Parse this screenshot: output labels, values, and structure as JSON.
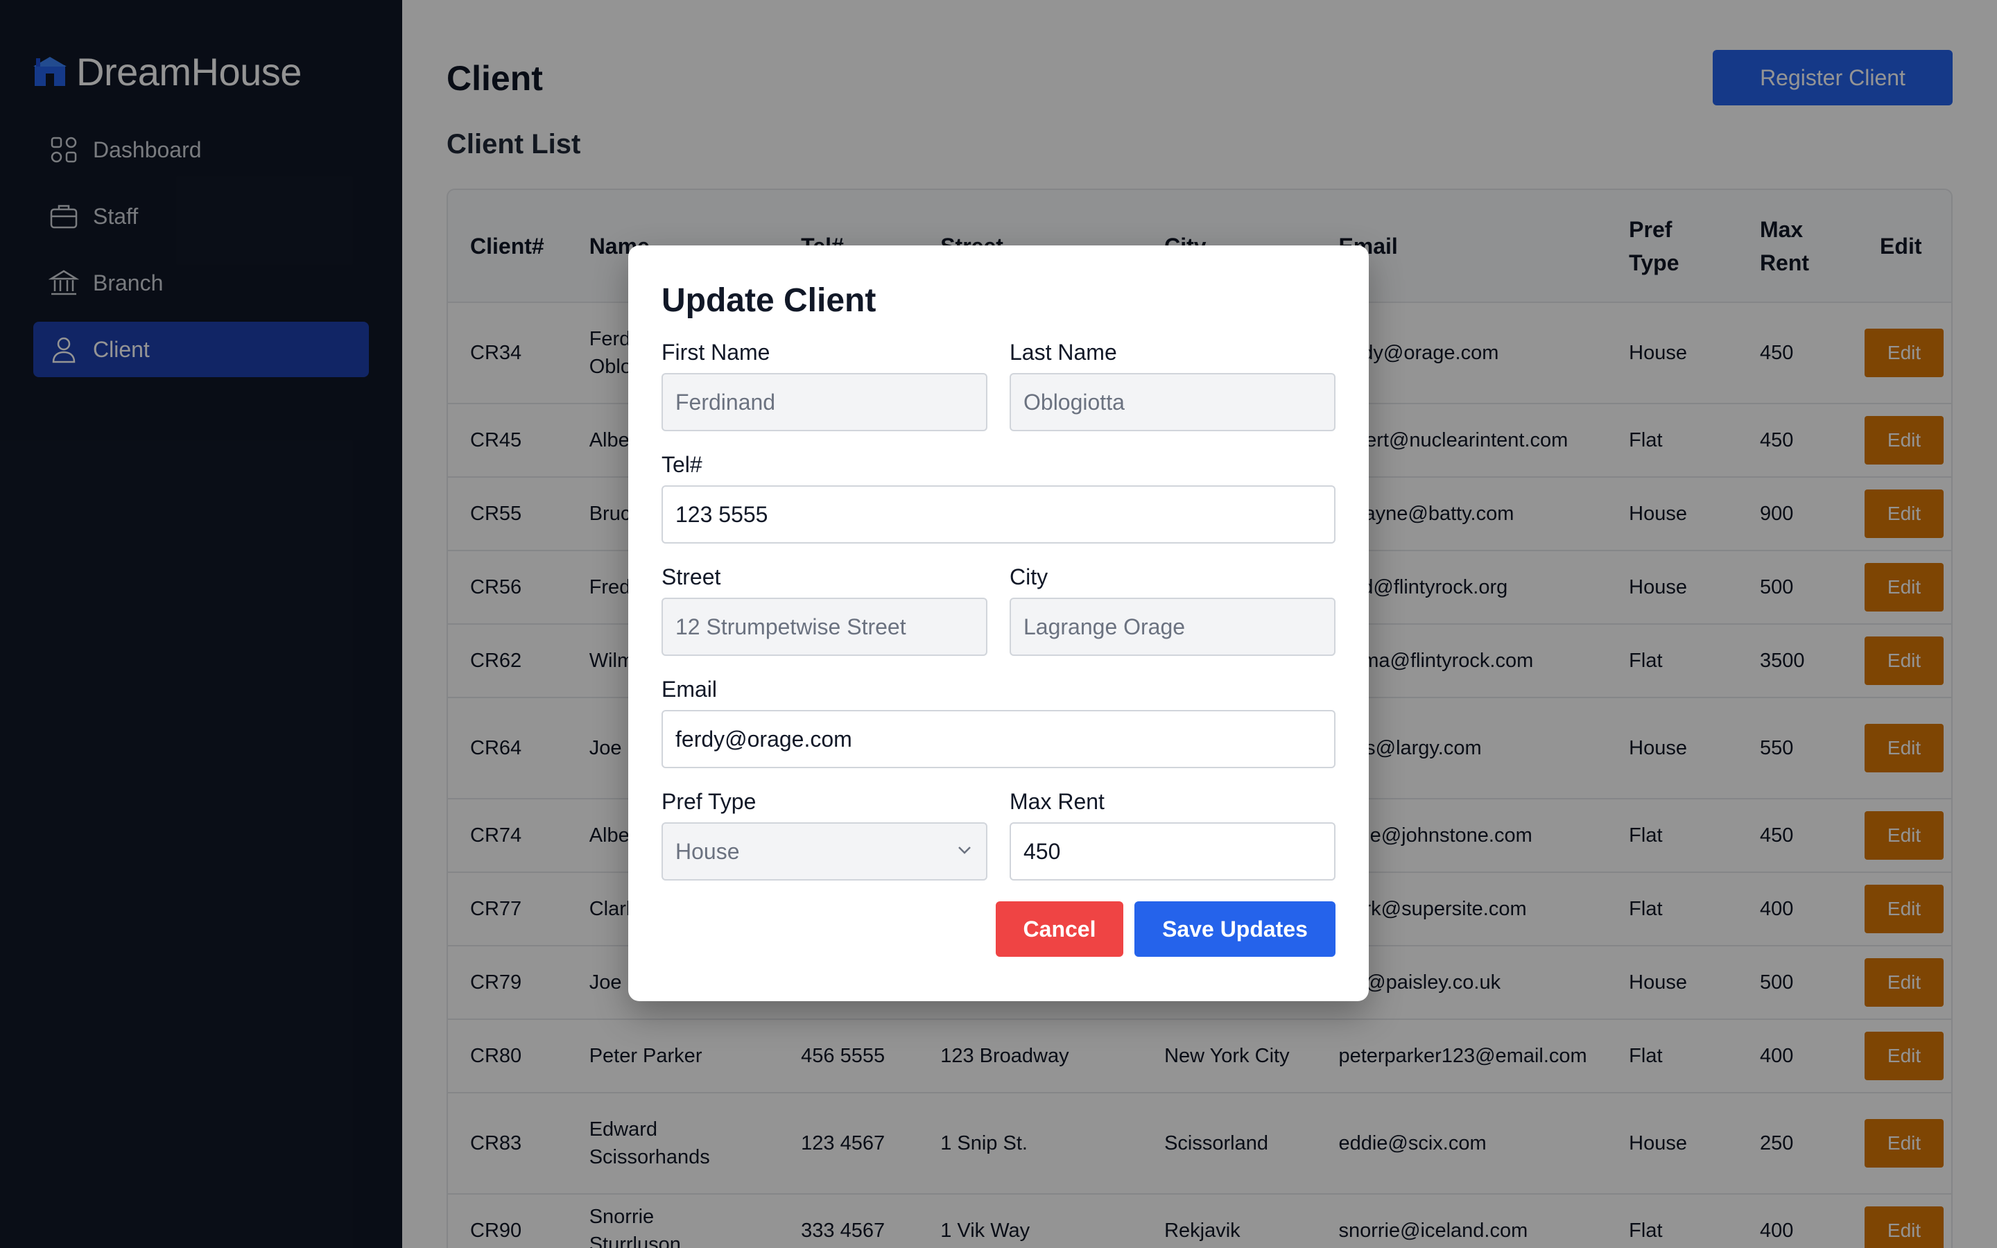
{
  "app": {
    "name": "DreamHouse"
  },
  "sidebar": {
    "items": [
      {
        "label": "Dashboard",
        "icon": "grid-icon"
      },
      {
        "label": "Staff",
        "icon": "briefcase-icon"
      },
      {
        "label": "Branch",
        "icon": "bank-icon"
      },
      {
        "label": "Client",
        "icon": "user-icon",
        "active": true
      }
    ]
  },
  "page": {
    "title": "Client",
    "register_label": "Register Client",
    "section_title": "Client List"
  },
  "table": {
    "headers": [
      "Client#",
      "Name",
      "Tel#",
      "Street",
      "City",
      "Email",
      "Pref Type",
      "Max Rent",
      "Edit"
    ],
    "edit_label": "Edit",
    "rows": [
      {
        "id": "CR34",
        "name": "Ferdinand Oblogiotta",
        "tel": "",
        "street": "",
        "city": "",
        "email": "ferdy@orage.com",
        "pref": "House",
        "rent": "450"
      },
      {
        "id": "CR45",
        "name": "Albert",
        "tel": "",
        "street": "",
        "city": "",
        "email": "albert@nuclearintent.com",
        "pref": "Flat",
        "rent": "450"
      },
      {
        "id": "CR55",
        "name": "Bruce",
        "tel": "",
        "street": "",
        "city": "",
        "email": "bwayne@batty.com",
        "pref": "House",
        "rent": "900"
      },
      {
        "id": "CR56",
        "name": "Fred",
        "tel": "",
        "street": "",
        "city": "",
        "email": "fred@flintyrock.org",
        "pref": "House",
        "rent": "500"
      },
      {
        "id": "CR62",
        "name": "Wilma",
        "tel": "",
        "street": "",
        "city": "",
        "email": "wilma@flintyrock.com",
        "pref": "Flat",
        "rent": "3500"
      },
      {
        "id": "CR64",
        "name": "Joe",
        "tel": "",
        "street": "",
        "city": "",
        "email": "joes@largy.com",
        "pref": "House",
        "rent": "550"
      },
      {
        "id": "CR74",
        "name": "Albert",
        "tel": "",
        "street": "",
        "city": "",
        "email": "albie@johnstone.com",
        "pref": "Flat",
        "rent": "450"
      },
      {
        "id": "CR77",
        "name": "Clark",
        "tel": "",
        "street": "",
        "city": "",
        "email": "clark@supersite.com",
        "pref": "Flat",
        "rent": "400"
      },
      {
        "id": "CR79",
        "name": "Joe",
        "tel": "",
        "street": "",
        "city": "",
        "email": "joe@paisley.co.uk",
        "pref": "House",
        "rent": "500"
      },
      {
        "id": "CR80",
        "name": "Peter Parker",
        "tel": "456 5555",
        "street": "123 Broadway",
        "city": "New York City",
        "email": "peterparker123@email.com",
        "pref": "Flat",
        "rent": "400"
      },
      {
        "id": "CR83",
        "name": "Edward Scissorhands",
        "tel": "123 4567",
        "street": "1 Snip St.",
        "city": "Scissorland",
        "email": "eddie@scix.com",
        "pref": "House",
        "rent": "250"
      },
      {
        "id": "CR90",
        "name": "Snorrie Sturrluson",
        "tel": "333 4567",
        "street": "1 Vik Way",
        "city": "Rekjavik",
        "email": "snorrie@iceland.com",
        "pref": "Flat",
        "rent": "400"
      }
    ]
  },
  "modal": {
    "title": "Update Client",
    "first_name_label": "First Name",
    "first_name": "Ferdinand",
    "last_name_label": "Last Name",
    "last_name": "Oblogiotta",
    "tel_label": "Tel#",
    "tel": "123 5555",
    "street_label": "Street",
    "street": "12 Strumpetwise Street",
    "city_label": "City",
    "city": "Lagrange Orage",
    "email_label": "Email",
    "email": "ferdy@orage.com",
    "pref_label": "Pref Type",
    "pref": "House",
    "rent_label": "Max Rent",
    "rent": "450",
    "cancel_label": "Cancel",
    "save_label": "Save Updates"
  }
}
